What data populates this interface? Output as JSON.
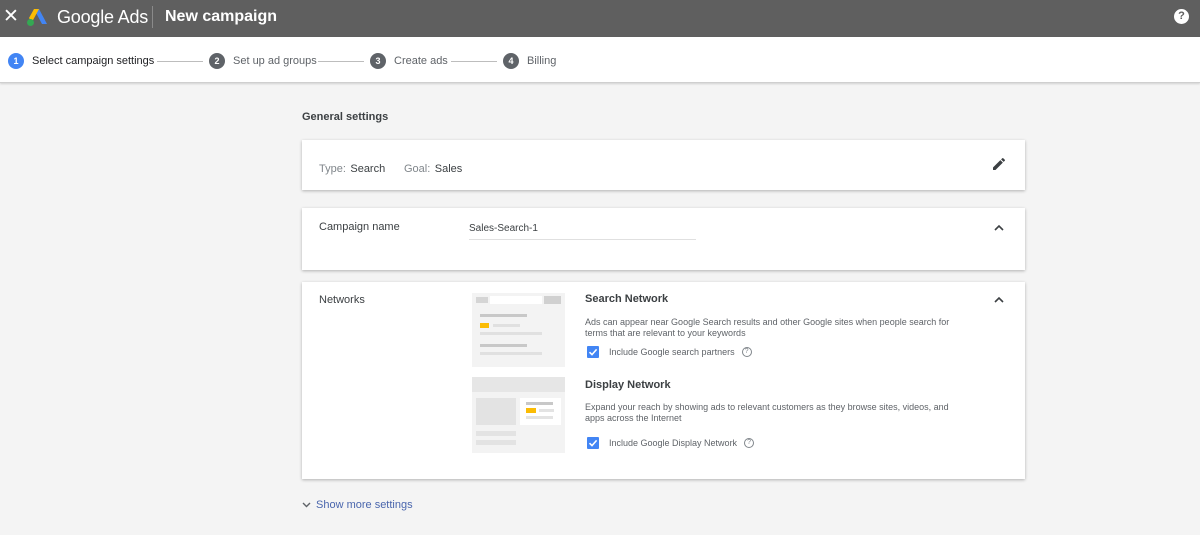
{
  "topbar": {
    "close_icon": "close-icon",
    "brand": "Google Ads",
    "title": "New campaign",
    "help_icon": "help-icon",
    "help_glyph": "?"
  },
  "stepper": {
    "steps": [
      {
        "number": "1",
        "label": "Select campaign settings",
        "active": true
      },
      {
        "number": "2",
        "label": "Set up ad groups",
        "active": false
      },
      {
        "number": "3",
        "label": "Create ads",
        "active": false
      },
      {
        "number": "4",
        "label": "Billing",
        "active": false
      }
    ]
  },
  "general": {
    "section_title": "General settings",
    "type_label": "Type:",
    "type_value": "Search",
    "goal_label": "Goal:",
    "goal_value": "Sales",
    "edit_icon": "pencil-icon"
  },
  "campaign_name": {
    "label": "Campaign name",
    "value": "Sales-Search-1"
  },
  "networks": {
    "label": "Networks",
    "search": {
      "title": "Search Network",
      "description": "Ads can appear near Google Search results and other Google sites when people search for terms that are relevant to your keywords",
      "checkbox_label": "Include Google search partners",
      "checked": true
    },
    "display": {
      "title": "Display Network",
      "description": "Expand your reach by showing ads to relevant customers as they browse sites, videos, and apps across the Internet",
      "checkbox_label": "Include Google Display Network",
      "checked": true
    },
    "help_glyph": "?"
  },
  "footer": {
    "show_more_label": "Show more settings"
  },
  "colors": {
    "topbar": "#5f5f5f",
    "accent_blue": "#4285f4",
    "link_blue": "#4a66ad",
    "ad_yellow": "#fbbc04",
    "background": "#f4f4f4"
  }
}
